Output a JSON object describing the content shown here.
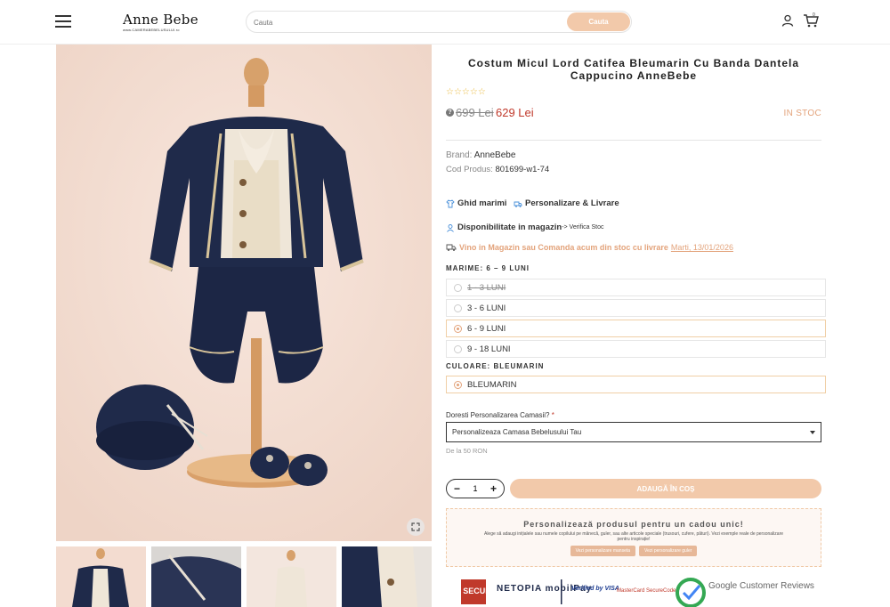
{
  "header": {
    "logo_brand": "Anne Bebe",
    "logo_subtitle": "www.CAMERABEBELUSULUI.ro",
    "search_placeholder": "Cauta",
    "search_button": "Cauta",
    "cart_count": "0"
  },
  "product": {
    "title": "Costum Micul Lord Catifea Bleumarin Cu Banda Dantela Cappucino AnneBebe",
    "stars": "☆☆☆☆☆",
    "old_price": "699 Lei",
    "new_price": "629 Lei",
    "stock_status": "IN STOC",
    "brand_label": "Brand:",
    "brand_value": "AnneBebe",
    "code_label": "Cod Produs:",
    "code_value": "801699-w1-74",
    "size_guide": "Ghid marimi",
    "personalize_delivery": "Personalizare & Livrare",
    "availability_label": "Disponibilitate in magazin",
    "availability_link": "-> Verifica Stoc",
    "delivery_text": "Vino in Magazin sau Comanda acum din stoc cu livrare",
    "delivery_date": "Marti, 13/01/2026",
    "size_section": "MARIME: 6 – 9 LUNI",
    "sizes": [
      {
        "label": "1 - 3 LUNI",
        "state": "disabled"
      },
      {
        "label": "3 - 6 LUNI",
        "state": "normal"
      },
      {
        "label": "6 - 9 LUNI",
        "state": "selected"
      },
      {
        "label": "9 - 18 LUNI",
        "state": "normal"
      }
    ],
    "color_section": "CULOARE: BLEUMARIN",
    "color_option": "BLEUMARIN",
    "personalize_question": "Doresti Personalizarea Camasii?",
    "personalize_required": "*",
    "personalize_select": "Personalizeaza Camasa Bebelusului Tau",
    "personalize_note": "De la 50 RON",
    "quantity": "1",
    "add_to_cart": "ADAUGĂ ÎN COȘ"
  },
  "promo": {
    "title": "Personalizează produsul pentru un cadou unic!",
    "text": "Alege să adaugi inițialele sau numele copilului pe mânecă, guler, sau alte articole speciale (trusouri, cufere, pături). Vezi exemple reale de personalizare pentru inspirație!",
    "button_sleeve": "Vezi personalizare manseta",
    "button_collar": "Vezi personalizare guler"
  },
  "badges": {
    "secure": "3D SECURE",
    "netopia": "NETOPIA mobilPay",
    "visa": "Verified by VISA",
    "mastercard": "MasterCard SecureCode",
    "google": "Google Customer Reviews"
  },
  "colors": {
    "accent": "#f2c9aa",
    "price": "#c0392b",
    "stock": "#e3a37b",
    "star": "#e9b93c",
    "navy": "#1f2a4a"
  }
}
